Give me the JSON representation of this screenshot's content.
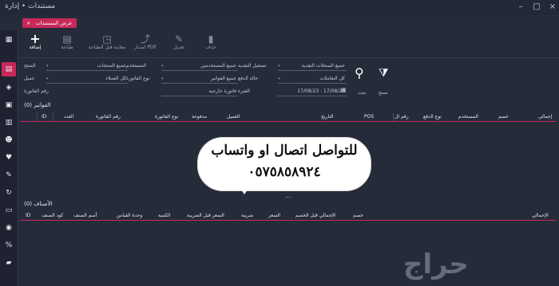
{
  "window": {
    "title": "مستندات • إدارة",
    "close": "×",
    "maximize": "□",
    "minimize": "–"
  },
  "tab": {
    "label": "عرض المستندات",
    "close": "×"
  },
  "sidebar": {
    "icons": [
      "grid-icon",
      "document-icon",
      "tag-icon",
      "box-icon",
      "report-icon",
      "users-icon",
      "heart-icon",
      "wrench-icon",
      "refresh-icon",
      "card-icon",
      "money-icon",
      "percent-icon",
      "folder-icon"
    ]
  },
  "toolbar": {
    "add": "إضافة",
    "print": "طباعة",
    "preview": "معاينة قبل الطباعة",
    "pdf": "اصدار PDF",
    "edit": "تعديل",
    "delete": "حذف"
  },
  "filters": {
    "row1": {
      "all_records_sel": "جميع السجلات النقدية",
      "cash_register_lbl": "تسجيل النقدية",
      "all_users_sel": "جميع المستخدمين",
      "user_lbl": "المستخدم",
      "all_products_sel": "جميع المنتجات",
      "product_lbl": "المنتج"
    },
    "row2": {
      "all_transactions_sel": "كل التعاملات",
      "payment_status_lbl": "حالة الدفع",
      "all_invoices_sel": "جميع الفواتير",
      "invoice_type_lbl": "نوع الفاتورة",
      "all_customers_sel": "كل العملاء",
      "customer_lbl": "عميل"
    },
    "row3": {
      "date_range": "17/08/23 : 17/08/23",
      "period_lbl": "الفترة",
      "external_invoice": "فاتورة خارجية",
      "invoice_number_lbl": "رقم الفاتورة"
    },
    "search_lbl": "بحث",
    "filter_lbl": "مسح"
  },
  "invoices": {
    "title": "الفواتير (0)",
    "columns": [
      "إجمالي",
      "خصم",
      "المستخدم",
      "نوع الدفع",
      "رقم ال",
      "POS",
      "التاريخ",
      "العميل",
      "مدفوعة",
      "نوع الفاتورة",
      "رقم الفاتورة",
      "العدد",
      "ID"
    ]
  },
  "items": {
    "title": "الأصناف (0)",
    "columns": [
      "الإجمالي",
      "خصم",
      "الإجمالي قبل الخصم",
      "السعر",
      "ضريبة",
      "السعر قبل الضريبة",
      "الكمية",
      "وحدة القياس",
      "أسم الصنف",
      "كود الصنف",
      "ID"
    ]
  },
  "overlay": {
    "line1": "للتواصل اتصال او واتساب",
    "line2": "٠٥٧٥٨٥٨٩٢٤",
    "dots": "..."
  },
  "watermark": "حراج",
  "colors": {
    "accent": "#c8285a",
    "background": "#262b3a"
  }
}
